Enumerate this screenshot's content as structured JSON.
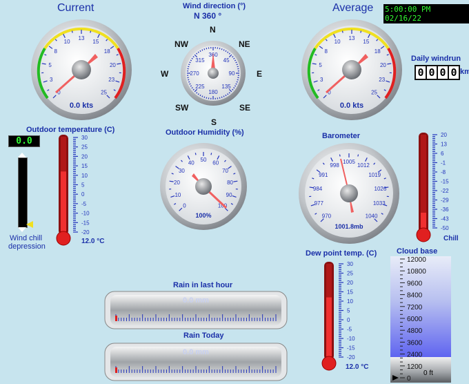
{
  "wind": {
    "current_title": "Current",
    "average_title": "Average",
    "datetime": "5:00:00 PM 02/16/22",
    "current_value": "0.0 kts",
    "average_value": "0.0 kts",
    "speed_ticks": [
      "0",
      "3",
      "5",
      "8",
      "10",
      "13",
      "15",
      "18",
      "20",
      "23",
      "25"
    ],
    "daily_windrun_label": "Daily windrun",
    "daily_windrun_digits": [
      "0",
      "0",
      "0",
      "0"
    ],
    "daily_windrun_unit": "km"
  },
  "direction": {
    "title": "Wind direction (°)",
    "readout": "N  360 °",
    "compass": {
      "N": "N",
      "NE": "NE",
      "E": "E",
      "SE": "SE",
      "S": "S",
      "SW": "SW",
      "W": "W",
      "NW": "NW"
    },
    "dial_labels": [
      "360",
      "45",
      "90",
      "135",
      "180",
      "225",
      "270",
      "315"
    ]
  },
  "temperature": {
    "title": "Outdoor temperature (C)",
    "digital": "0.0",
    "value_label": "12.0 °C",
    "scale": [
      "30",
      "25",
      "20",
      "15",
      "10",
      "5",
      "0",
      "-5",
      "-10",
      "-15",
      "-20"
    ],
    "level": 12.0
  },
  "windchill": {
    "label_line1": "Wind chill",
    "label_line2": "depression",
    "chill_label": "Chill",
    "chill_scale": [
      "20",
      "13",
      "6",
      "-1",
      "-8",
      "-15",
      "-22",
      "-29",
      "-36",
      "-43",
      "-50"
    ]
  },
  "humidity": {
    "title": "Outdoor Humidity (%)",
    "value_label": "100%",
    "ticks": [
      "0",
      "10",
      "20",
      "30",
      "40",
      "50",
      "60",
      "70",
      "80",
      "90",
      "100"
    ]
  },
  "barometer": {
    "title": "Barometer",
    "value_label": "1001.8mb",
    "ticks": [
      "970",
      "977",
      "984",
      "991",
      "998",
      "1005",
      "1012",
      "1019",
      "1026",
      "1033",
      "1040"
    ]
  },
  "dewpoint": {
    "title": "Dew point temp. (C)",
    "value_label": "12.0 °C",
    "scale": [
      "30",
      "25",
      "20",
      "15",
      "10",
      "5",
      "0",
      "-5",
      "-10",
      "-15",
      "-20"
    ],
    "level": 12.0
  },
  "cloudbase": {
    "title": "Cloud base",
    "scale": [
      "12000",
      "10800",
      "9600",
      "8400",
      "7200",
      "6000",
      "4800",
      "3600",
      "2400",
      "1200",
      "0"
    ],
    "value_label": "0 ft"
  },
  "rain": {
    "last_hour_title": "Rain in last hour",
    "last_hour_value": "0.0 mm",
    "today_title": "Rain Today",
    "today_value": "0.0 mm"
  },
  "colors": {
    "background": "#c7e4ee",
    "label_blue": "#1a2fa8",
    "needle_red": "#e03030",
    "digital_green": "#33ff33"
  }
}
